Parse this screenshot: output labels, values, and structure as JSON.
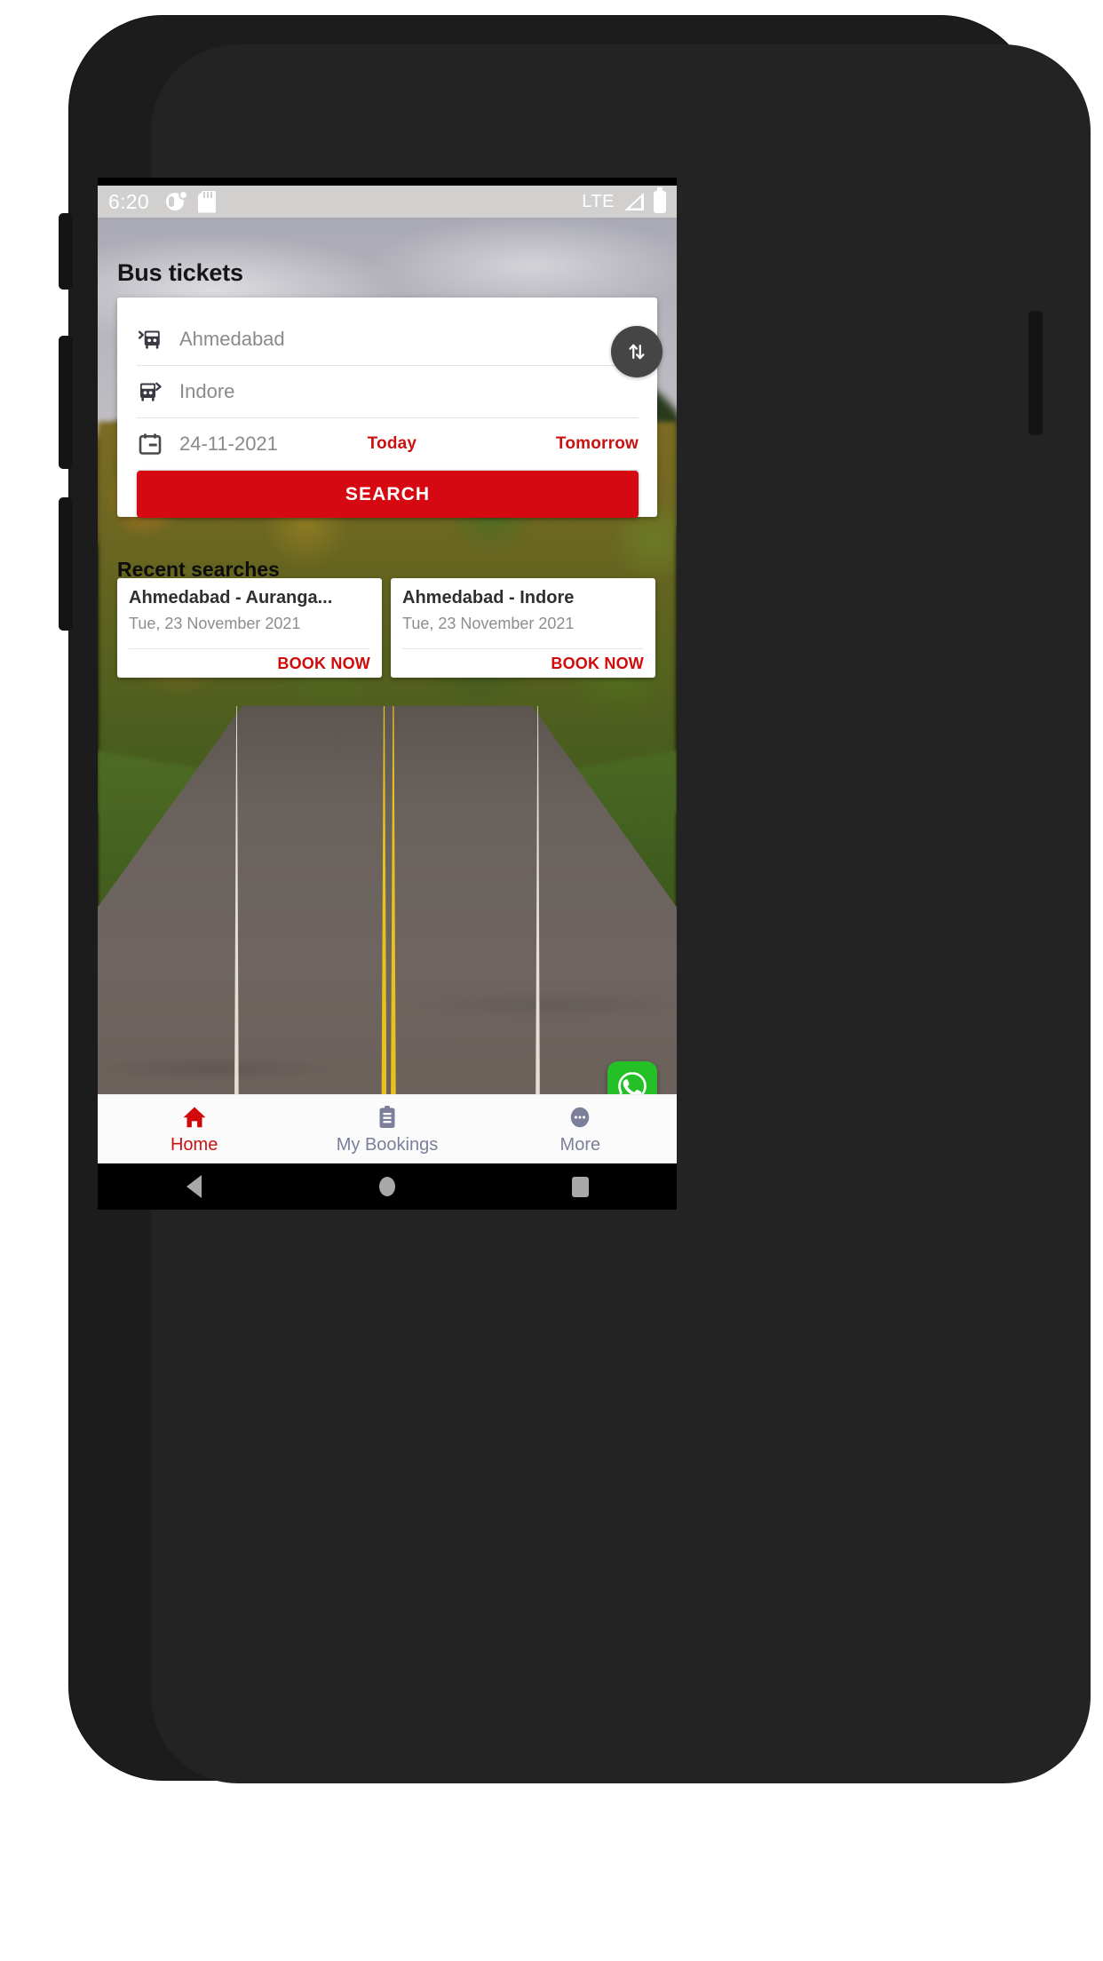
{
  "status_bar": {
    "time": "6:20",
    "icons_left": [
      "do-not-disturb-icon",
      "sd-card-icon"
    ],
    "network": "LTE",
    "icons_right": [
      "signal-icon",
      "battery-icon"
    ]
  },
  "header": {
    "title": "Bus tickets"
  },
  "search_card": {
    "from": {
      "value": "Ahmedabad",
      "icon": "bus-departure-icon"
    },
    "to": {
      "value": "Indore",
      "icon": "bus-arrival-icon"
    },
    "date": {
      "value": "24-11-2021",
      "icon": "calendar-icon"
    },
    "today_label": "Today",
    "tomorrow_label": "Tomorrow",
    "swap_icon": "swap-vertical-icon",
    "search_label": "SEARCH"
  },
  "recent": {
    "heading": "Recent searches",
    "cards": [
      {
        "route": "Ahmedabad - Auranga...",
        "date": "Tue, 23 November 2021",
        "book_label": "BOOK NOW"
      },
      {
        "route": "Ahmedabad - Indore",
        "date": "Tue, 23 November 2021",
        "book_label": "BOOK NOW"
      }
    ]
  },
  "fab": {
    "icon": "whatsapp-icon"
  },
  "bottom_nav": {
    "items": [
      {
        "label": "Home",
        "icon": "home-icon",
        "active": true
      },
      {
        "label": "My Bookings",
        "icon": "clipboard-icon",
        "active": false
      },
      {
        "label": "More",
        "icon": "ellipsis-circle-icon",
        "active": false
      }
    ]
  },
  "android_nav": {
    "back": "back-triangle-icon",
    "home": "home-circle-icon",
    "recents": "recents-square-icon"
  },
  "colors": {
    "brand_red": "#d60812",
    "accent_red": "#cc1111",
    "whatsapp_green": "#25c028",
    "nav_inactive": "#7b7f9a"
  }
}
